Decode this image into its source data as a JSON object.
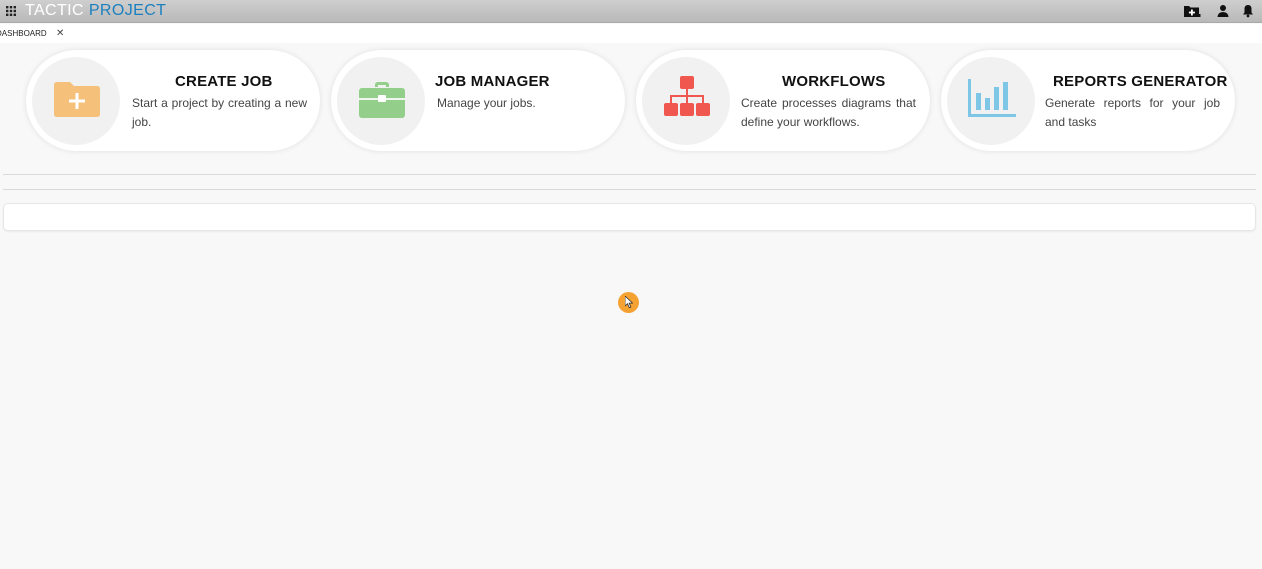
{
  "app": {
    "brand_part1": "TACTIC",
    "brand_part2": "PROJECT",
    "accent_color": "#1b7fbf"
  },
  "topbar_icons": [
    "apps-grid-icon",
    "add-folder-icon",
    "user-icon",
    "bell-icon"
  ],
  "tabs": [
    {
      "label": "DASHBOARD",
      "active": true
    }
  ],
  "cards": [
    {
      "title": "CREATE JOB",
      "description": "Start a project by creating a new job.",
      "icon": "folder-plus-icon",
      "icon_color": "#f5c07a"
    },
    {
      "title": "JOB MANAGER",
      "description": "Manage your jobs.",
      "icon": "briefcase-icon",
      "icon_color": "#93cf8a"
    },
    {
      "title": "WORKFLOWS",
      "description": "Create processes diagrams that define your workflows.",
      "icon": "sitemap-icon",
      "icon_color": "#f0574f"
    },
    {
      "title": "REPORTS GENERATOR",
      "description": "Generate reports for your job and tasks",
      "icon": "bar-chart-icon",
      "icon_color": "#7ec6e6"
    }
  ],
  "cursor_color": "#f5a233"
}
